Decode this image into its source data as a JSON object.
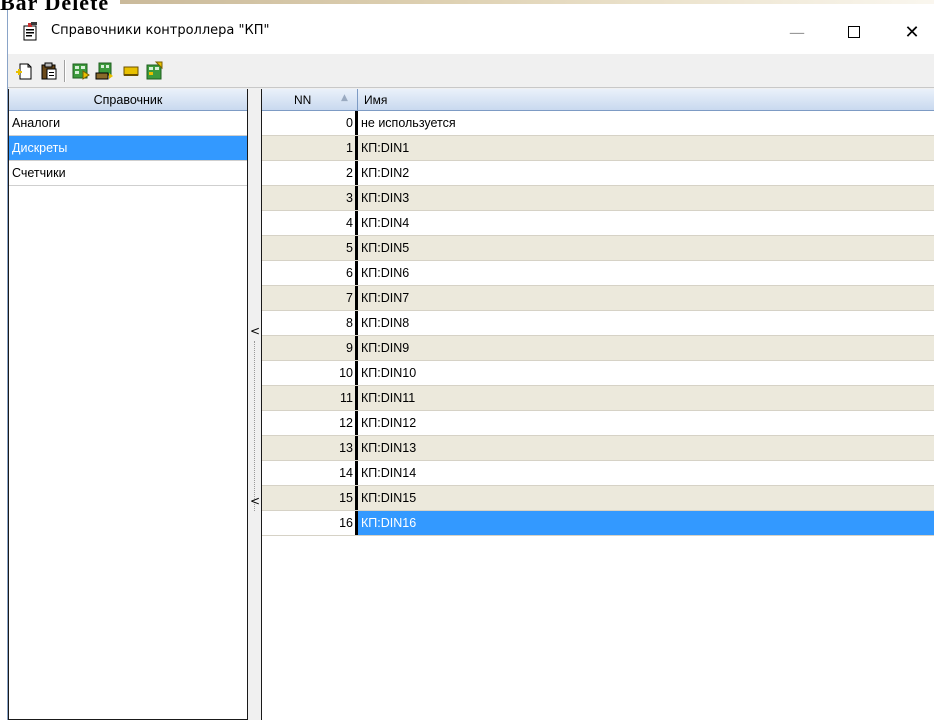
{
  "background": {
    "partial_text": "Bar Delete"
  },
  "window": {
    "title": "Справочники контроллера \"КП\"",
    "buttons": {
      "minimize": "—",
      "close": "✕"
    }
  },
  "toolbar": {
    "buttons": [
      {
        "name": "new-item-icon"
      },
      {
        "name": "paste-icon"
      },
      {
        "name": "export-excel-icon"
      },
      {
        "name": "import-excel-icon"
      },
      {
        "name": "flag-icon"
      },
      {
        "name": "table-export-icon"
      }
    ]
  },
  "left_table": {
    "header": "Справочник",
    "rows": [
      "Аналоги",
      "Дискреты",
      "Счетчики"
    ],
    "selected_index": 1
  },
  "right_table": {
    "headers": {
      "nn": "NN",
      "name": "Имя"
    },
    "sort_indicator": "▲",
    "rows": [
      {
        "nn": "0",
        "name": "не используется"
      },
      {
        "nn": "1",
        "name": "КП:DIN1"
      },
      {
        "nn": "2",
        "name": "КП:DIN2"
      },
      {
        "nn": "3",
        "name": "КП:DIN3"
      },
      {
        "nn": "4",
        "name": "КП:DIN4"
      },
      {
        "nn": "5",
        "name": "КП:DIN5"
      },
      {
        "nn": "6",
        "name": "КП:DIN6"
      },
      {
        "nn": "7",
        "name": "КП:DIN7"
      },
      {
        "nn": "8",
        "name": "КП:DIN8"
      },
      {
        "nn": "9",
        "name": "КП:DIN9"
      },
      {
        "nn": "10",
        "name": "КП:DIN10"
      },
      {
        "nn": "11",
        "name": "КП:DIN11"
      },
      {
        "nn": "12",
        "name": "КП:DIN12"
      },
      {
        "nn": "13",
        "name": "КП:DIN13"
      },
      {
        "nn": "14",
        "name": "КП:DIN14"
      },
      {
        "nn": "15",
        "name": "КП:DIN15"
      },
      {
        "nn": "16",
        "name": "КП:DIN16"
      }
    ],
    "selected_index": 16
  },
  "splitter": {
    "arrow": "<"
  },
  "colors": {
    "selection": "#3399ff",
    "alt_row": "#ece9dc",
    "header_gradient_top": "#eaf1fa",
    "header_gradient_bottom": "#c9d9ef"
  }
}
